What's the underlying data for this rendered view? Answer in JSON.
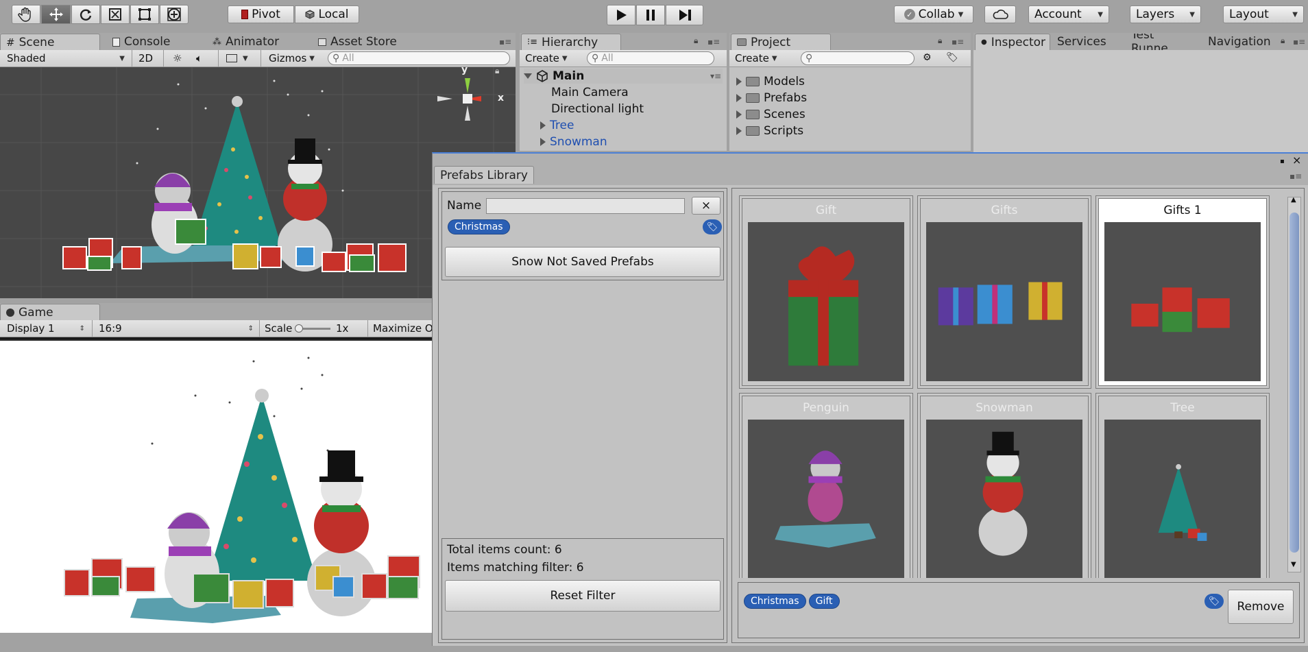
{
  "toolbar": {
    "pivot_label": "Pivot",
    "local_label": "Local",
    "collab_label": "Collab",
    "account_label": "Account",
    "layers_label": "Layers",
    "layout_label": "Layout",
    "tools": [
      "hand-tool-icon",
      "move-tool-icon",
      "rotate-tool-icon",
      "scale-tool-icon",
      "rect-tool-icon",
      "transform-tool-icon"
    ]
  },
  "scene": {
    "tabs": [
      {
        "label": "Scene"
      },
      {
        "label": "Console"
      },
      {
        "label": "Animator"
      },
      {
        "label": "Asset Store"
      }
    ],
    "shading_value": "Shaded",
    "mode_2d": "2D",
    "gizmos_label": "Gizmos",
    "search_placeholder": "All",
    "axis_y": "y",
    "axis_x": "x"
  },
  "game": {
    "tab_label": "Game",
    "display_value": "Display 1",
    "aspect_value": "16:9",
    "scale_label": "Scale",
    "scale_value": "1x",
    "maximize_label": "Maximize O"
  },
  "hierarchy": {
    "tab_label": "Hierarchy",
    "create_label": "Create",
    "search_placeholder": "All",
    "scene_name": "Main",
    "items": [
      {
        "label": "Main Camera"
      },
      {
        "label": "Directional light"
      },
      {
        "label": "Tree"
      },
      {
        "label": "Snowman"
      }
    ]
  },
  "project": {
    "tab_label": "Project",
    "create_label": "Create",
    "folders": [
      {
        "label": "Models"
      },
      {
        "label": "Prefabs"
      },
      {
        "label": "Scenes"
      },
      {
        "label": "Scripts"
      }
    ]
  },
  "inspector_tabs": [
    {
      "label": "Inspector"
    },
    {
      "label": "Services"
    },
    {
      "label": "Test Runne"
    },
    {
      "label": "Navigation"
    }
  ],
  "prefabs_library": {
    "title": "Prefabs Library",
    "name_label": "Name",
    "name_value": "",
    "clear_label": "×",
    "filter_tags": [
      "Christmas"
    ],
    "show_button": "Snow Not Saved Prefabs",
    "total_label": "Total items count: 6",
    "matching_label": "Items matching filter: 6",
    "reset_button": "Reset Filter",
    "items": [
      {
        "name": "Gift",
        "selected": false
      },
      {
        "name": "Gifts",
        "selected": false
      },
      {
        "name": "Gifts 1",
        "selected": true
      },
      {
        "name": "Penguin",
        "selected": false
      },
      {
        "name": "Snowman",
        "selected": false
      },
      {
        "name": "Tree",
        "selected": false
      }
    ],
    "selected_tags": [
      "Christmas",
      "Gift"
    ],
    "remove_button": "Remove"
  },
  "colors": {
    "tag_blue": "#2a5fb4",
    "scene_bg": "#474747",
    "game_bg": "#ffffff",
    "prefab_bg": "#4f4f4f",
    "tree_green": "#1e8a80",
    "gift_red": "#c8322a",
    "gift_green": "#3a8a3a"
  }
}
